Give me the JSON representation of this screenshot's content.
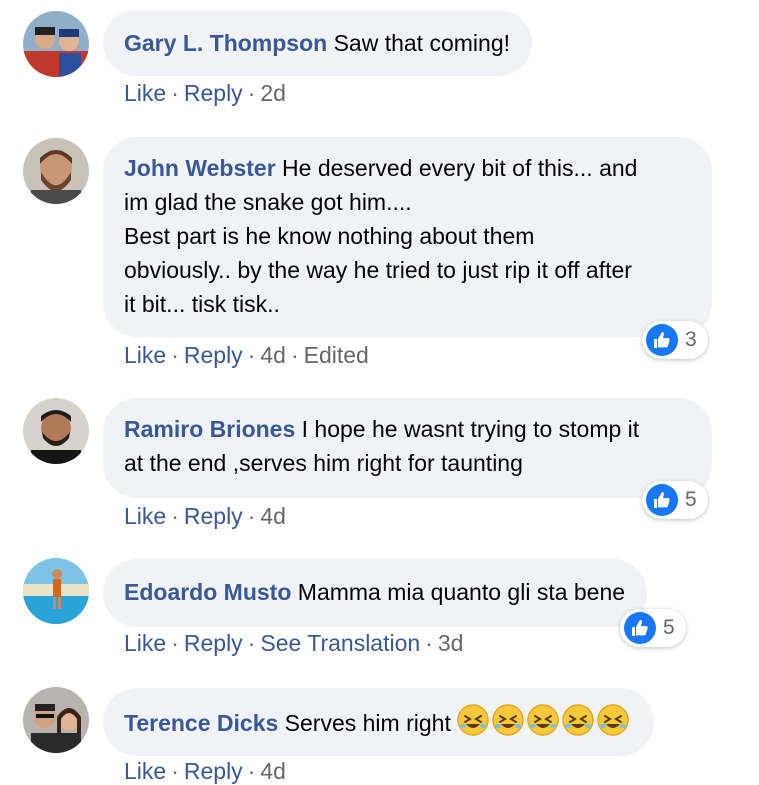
{
  "comments": [
    {
      "author": "Gary L. Thompson",
      "text": "Saw that coming!",
      "actions": {
        "like": "Like",
        "reply": "Reply",
        "time": "2d"
      }
    },
    {
      "author": "John Webster",
      "text": "He deserved every bit of this... and\nim glad the snake got him....\nBest part is he know nothing about them\nobviously.. by the way he tried to just rip it off after\nit bit... tisk tisk..",
      "actions": {
        "like": "Like",
        "reply": "Reply",
        "time": "4d",
        "edited": "Edited"
      },
      "reactions": "3"
    },
    {
      "author": "Ramiro Briones",
      "text": "I hope he wasnt trying to stomp it\nat the end ,serves him right for taunting",
      "actions": {
        "like": "Like",
        "reply": "Reply",
        "time": "4d"
      },
      "reactions": "5"
    },
    {
      "author": "Edoardo Musto",
      "text": "Mamma mia quanto gli sta bene",
      "actions": {
        "like": "Like",
        "reply": "Reply",
        "translate": "See Translation",
        "time": "3d"
      },
      "reactions": "5"
    },
    {
      "author": "Terence Dicks",
      "text": "Serves him right",
      "emojis": [
        "rolling-on-floor-laughing-emoji",
        "rolling-on-floor-laughing-emoji",
        "rolling-on-floor-laughing-emoji",
        "rolling-on-floor-laughing-emoji",
        "rolling-on-floor-laughing-emoji"
      ],
      "actions": {
        "like": "Like",
        "reply": "Reply",
        "time": "4d"
      }
    }
  ],
  "icons": {
    "reaction": "like-thumb-icon"
  },
  "colors": {
    "author": "#385898",
    "bubble": "#f0f2f5",
    "meta": "#65676b",
    "like_blue": "#1877f2"
  }
}
